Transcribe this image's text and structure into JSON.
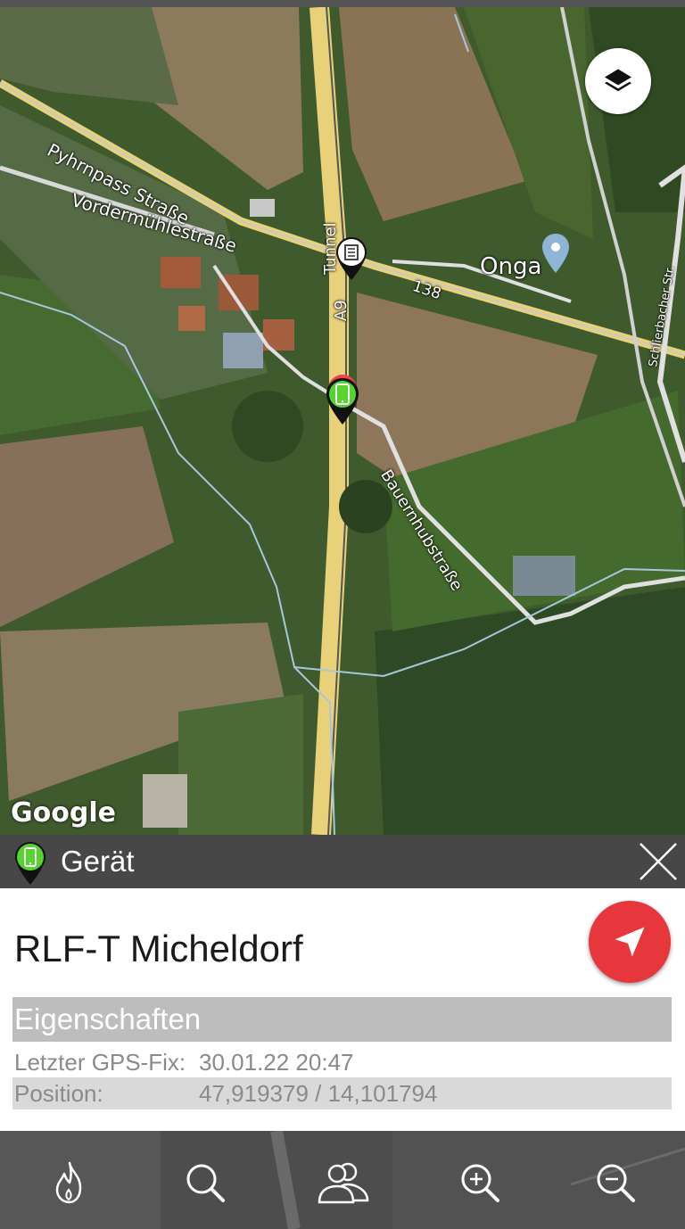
{
  "map": {
    "labels": {
      "pyhrnpass": "Pyhrnpass Straße",
      "vordermuehl": "Vordermühlestraße",
      "tunnel": "Tunnel",
      "a9": "A9",
      "bauernhub": "Bauernhubstraße",
      "route_138": "138",
      "onga": "Onga",
      "schlierbacher": "Schlierbacher Str."
    },
    "attribution": "Google",
    "layers_icon": "layers-icon",
    "colors": {
      "field_dark": "#3f5a2c",
      "field_brown": "#8a7355",
      "road_yellow": "#e8d27a"
    }
  },
  "panel": {
    "header_title": "Gerät",
    "header_icon": "device-pin-icon",
    "close_icon": "close-icon",
    "device_name": "RLF-T Micheldorf",
    "navigate_icon": "navigation-arrow-icon",
    "properties_heading": "Eigenschaften",
    "gps_fix_label": "Letzter GPS-Fix:",
    "gps_fix_value": "30.01.22 20:47",
    "position_label": "Position:",
    "position_value": "47,919379 / 14,101794",
    "colors": {
      "header_bg": "#474747",
      "navigate_red": "#e8363d",
      "pin_green": "#55d52b"
    }
  },
  "toolbar": {
    "items": [
      {
        "name": "fire",
        "icon": "flame-icon"
      },
      {
        "name": "search",
        "icon": "search-icon"
      },
      {
        "name": "groups",
        "icon": "users-icon"
      },
      {
        "name": "zoom_in",
        "icon": "zoom-in-icon"
      },
      {
        "name": "zoom_out",
        "icon": "zoom-out-icon"
      }
    ]
  }
}
